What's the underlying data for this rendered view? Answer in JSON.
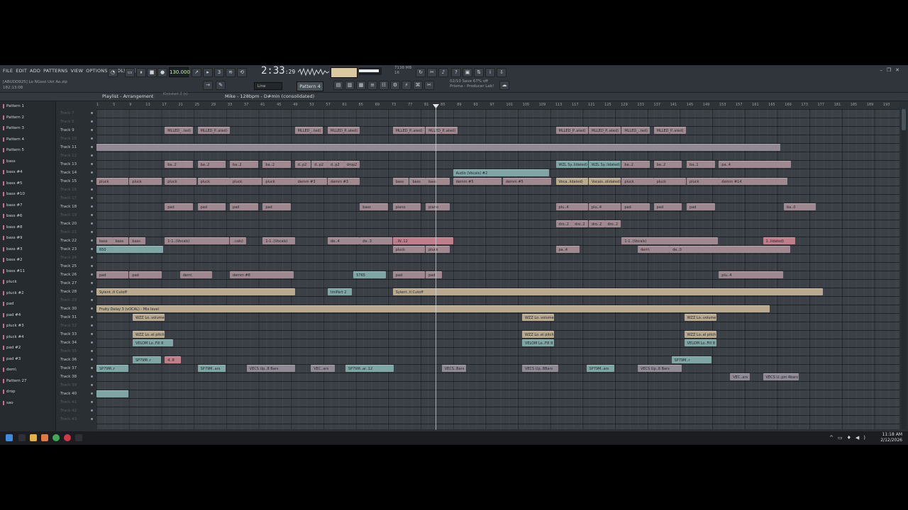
{
  "menu": [
    "FILE",
    "EDIT",
    "ADD",
    "PATTERNS",
    "VIEW",
    "OPTIONS",
    "TOOLS",
    "HELP"
  ],
  "project": {
    "file": "[ABUDD925] Lo NGooi Uot Ao.zip",
    "position": "182:13:08",
    "track_hint": "Track 26"
  },
  "transport": {
    "tempo": "130.000",
    "time_main": "2:33",
    "time_sub": ":29",
    "cpu": "7138 MB",
    "cpu2": "16"
  },
  "toolbar": {
    "snap": "Line",
    "pattern": "Pattern 4"
  },
  "news": {
    "line1": "02/10 Save 67% off",
    "line2": "Prisma - Producer Lab!"
  },
  "playlist": {
    "title": "Playlist - Arrangement",
    "sub": "Kickstart 2 (s)",
    "arrangement": "Mike - 128bpm - D#min (consolidated)"
  },
  "ruler": [
    "1",
    "5",
    "9",
    "13",
    "17",
    "21",
    "25",
    "29",
    "33",
    "37",
    "41",
    "45",
    "49",
    "53",
    "57",
    "61",
    "65",
    "69",
    "73",
    "77",
    "81",
    "85",
    "89",
    "93",
    "97",
    "101",
    "105",
    "109",
    "113",
    "117",
    "121",
    "125",
    "129",
    "133",
    "137",
    "141",
    "145",
    "149",
    "153",
    "157",
    "161",
    "165",
    "169",
    "173",
    "177",
    "181",
    "185",
    "189",
    "193"
  ],
  "picker": [
    "Pattern 1",
    "Pattern 2",
    "Pattern 3",
    "Pattern 4",
    "Pattern 5",
    "bass",
    "bass #4",
    "bass #5",
    "bass #10",
    "bass #7",
    "bass #6",
    "bass #8",
    "bass #9",
    "bass #3",
    "bass #2",
    "bass #11",
    "pluck",
    "pluck #2",
    "pad",
    "pad #4",
    "pluck #3",
    "pluck #4",
    "pad #2",
    "pad #3",
    "dem\\",
    "Pattern 27",
    "drop",
    "sao"
  ],
  "tracks": [
    {
      "name": "Track 7",
      "dim": true
    },
    {
      "name": "Track 8",
      "dim": true
    },
    {
      "name": "Track 9"
    },
    {
      "name": "Track 10",
      "dim": true
    },
    {
      "name": "Track 11"
    },
    {
      "name": "Track 12",
      "dim": true
    },
    {
      "name": "Track 13"
    },
    {
      "name": "Track 14"
    },
    {
      "name": "Track 15"
    },
    {
      "name": "Track 16",
      "dim": true
    },
    {
      "name": "Track 17",
      "dim": true
    },
    {
      "name": "Track 18"
    },
    {
      "name": "Track 19",
      "dim": true
    },
    {
      "name": "Track 20"
    },
    {
      "name": "Track 21",
      "dim": true
    },
    {
      "name": "Track 22"
    },
    {
      "name": "Track 23"
    },
    {
      "name": "Track 24",
      "dim": true
    },
    {
      "name": "Track 25"
    },
    {
      "name": "Track 26"
    },
    {
      "name": "Track 27"
    },
    {
      "name": "Track 28"
    },
    {
      "name": "Track 29",
      "dim": true
    },
    {
      "name": "Track 30"
    },
    {
      "name": "Track 31"
    },
    {
      "name": "Track 32",
      "dim": true
    },
    {
      "name": "Track 33"
    },
    {
      "name": "Track 34"
    },
    {
      "name": "Track 35",
      "dim": true
    },
    {
      "name": "Track 36"
    },
    {
      "name": "Track 37"
    },
    {
      "name": "Track 38"
    },
    {
      "name": "Track 39",
      "dim": true
    },
    {
      "name": "Track 40"
    },
    {
      "name": "Track 41",
      "dim": true
    },
    {
      "name": "Track 42",
      "dim": true
    },
    {
      "name": "Track 43",
      "dim": true
    }
  ],
  "clips": [
    {
      "row": 2,
      "label": "MLLED_..ted)",
      "color": "a",
      "start": 0.085,
      "len": 0.035
    },
    {
      "row": 2,
      "label": "MLLED_P..ated)",
      "color": "a",
      "start": 0.126,
      "len": 0.04
    },
    {
      "row": 2,
      "label": "MLLED_..ted)",
      "color": "a",
      "start": 0.247,
      "len": 0.035
    },
    {
      "row": 2,
      "label": "MLLED_P..ated)",
      "color": "a",
      "start": 0.288,
      "len": 0.04
    },
    {
      "row": 2,
      "label": "MLLED_P..ated)",
      "color": "a",
      "start": 0.369,
      "len": 0.04
    },
    {
      "row": 2,
      "label": "MLLED_P..ated)",
      "color": "a",
      "start": 0.41,
      "len": 0.04
    },
    {
      "row": 2,
      "label": "MLLED_P..ated)",
      "color": "a",
      "start": 0.572,
      "len": 0.04
    },
    {
      "row": 2,
      "label": "MLLED_P..ated)",
      "color": "a",
      "start": 0.613,
      "len": 0.04
    },
    {
      "row": 2,
      "label": "MLLED_..ted)",
      "color": "a",
      "start": 0.654,
      "len": 0.035
    },
    {
      "row": 2,
      "label": "MLLED_P..ated)",
      "color": "a",
      "start": 0.694,
      "len": 0.04
    },
    {
      "row": 4,
      "label": "",
      "color": "b",
      "start": 0.0,
      "len": 0.852
    },
    {
      "row": 6,
      "label": "ba..2",
      "color": "a",
      "start": 0.085,
      "len": 0.035
    },
    {
      "row": 6,
      "label": "ba..2",
      "color": "a",
      "start": 0.126,
      "len": 0.035
    },
    {
      "row": 6,
      "label": "ba..2",
      "color": "a",
      "start": 0.166,
      "len": 0.035
    },
    {
      "row": 6,
      "label": "ba..2",
      "color": "a",
      "start": 0.207,
      "len": 0.035
    },
    {
      "row": 6,
      "label": "d..p2",
      "color": "a",
      "start": 0.247,
      "len": 0.02
    },
    {
      "row": 6,
      "label": "d..p2",
      "color": "a",
      "start": 0.268,
      "len": 0.02
    },
    {
      "row": 6,
      "label": "d..p2",
      "color": "a",
      "start": 0.288,
      "len": 0.02
    },
    {
      "row": 6,
      "label": "drop2",
      "color": "a",
      "start": 0.308,
      "len": 0.02
    },
    {
      "row": 6,
      "label": "WZL Sy..lidated)",
      "color": "c",
      "start": 0.572,
      "len": 0.04
    },
    {
      "row": 6,
      "label": "WZL Sy..lidated)",
      "color": "c",
      "start": 0.613,
      "len": 0.04
    },
    {
      "row": 6,
      "label": "ba..2",
      "color": "a",
      "start": 0.654,
      "len": 0.035
    },
    {
      "row": 6,
      "label": "ba..2",
      "color": "a",
      "start": 0.694,
      "len": 0.035
    },
    {
      "row": 6,
      "label": "ba..1",
      "color": "a",
      "start": 0.735,
      "len": 0.035
    },
    {
      "row": 6,
      "label": "pa..4",
      "color": "a",
      "start": 0.775,
      "len": 0.09
    },
    {
      "row": 7,
      "label": "Audio (Vocals) #2",
      "color": "c",
      "start": 0.444,
      "len": 0.12
    },
    {
      "row": 8,
      "label": "pluck",
      "color": "a",
      "start": 0.0,
      "len": 0.04
    },
    {
      "row": 8,
      "label": "pluck",
      "color": "a",
      "start": 0.041,
      "len": 0.04
    },
    {
      "row": 8,
      "label": "pluck",
      "color": "a",
      "start": 0.085,
      "len": 0.04
    },
    {
      "row": 8,
      "label": "pluck",
      "color": "a",
      "start": 0.126,
      "len": 0.04
    },
    {
      "row": 8,
      "label": "pluck",
      "color": "a",
      "start": 0.166,
      "len": 0.04
    },
    {
      "row": 8,
      "label": "pluck",
      "color": "a",
      "start": 0.207,
      "len": 0.04
    },
    {
      "row": 8,
      "label": "demm #3",
      "color": "a",
      "start": 0.247,
      "len": 0.04
    },
    {
      "row": 8,
      "label": "demm #3",
      "color": "a",
      "start": 0.288,
      "len": 0.04
    },
    {
      "row": 8,
      "label": "bass",
      "color": "a",
      "start": 0.369,
      "len": 0.02
    },
    {
      "row": 8,
      "label": "bass",
      "color": "a",
      "start": 0.39,
      "len": 0.02
    },
    {
      "row": 8,
      "label": "bass",
      "color": "a",
      "start": 0.41,
      "len": 0.03
    },
    {
      "row": 8,
      "label": "demm #5",
      "color": "a",
      "start": 0.444,
      "len": 0.06
    },
    {
      "row": 8,
      "label": "demm #5",
      "color": "a",
      "start": 0.506,
      "len": 0.06
    },
    {
      "row": 8,
      "label": "Voca..lidated)",
      "color": "d",
      "start": 0.572,
      "len": 0.04
    },
    {
      "row": 8,
      "label": "Vocals..olidated)",
      "color": "d",
      "start": 0.613,
      "len": 0.04
    },
    {
      "row": 8,
      "label": "pluck",
      "color": "a",
      "start": 0.654,
      "len": 0.04
    },
    {
      "row": 8,
      "label": "pluck",
      "color": "a",
      "start": 0.694,
      "len": 0.04
    },
    {
      "row": 8,
      "label": "pluck",
      "color": "a",
      "start": 0.735,
      "len": 0.04
    },
    {
      "row": 8,
      "label": "demm #14",
      "color": "a",
      "start": 0.775,
      "len": 0.085
    },
    {
      "row": 11,
      "label": "pad",
      "color": "a",
      "start": 0.085,
      "len": 0.035
    },
    {
      "row": 11,
      "label": "pad",
      "color": "a",
      "start": 0.126,
      "len": 0.035
    },
    {
      "row": 11,
      "label": "pad",
      "color": "a",
      "start": 0.166,
      "len": 0.035
    },
    {
      "row": 11,
      "label": "pad",
      "color": "a",
      "start": 0.207,
      "len": 0.035
    },
    {
      "row": 11,
      "label": "bass",
      "color": "a",
      "start": 0.328,
      "len": 0.035
    },
    {
      "row": 11,
      "label": "piano",
      "color": "a",
      "start": 0.369,
      "len": 0.035
    },
    {
      "row": 11,
      "label": "piano",
      "color": "a",
      "start": 0.41,
      "len": 0.03
    },
    {
      "row": 11,
      "label": "plu..4",
      "color": "a",
      "start": 0.572,
      "len": 0.04
    },
    {
      "row": 11,
      "label": "plu..4",
      "color": "a",
      "start": 0.613,
      "len": 0.04
    },
    {
      "row": 11,
      "label": "pad",
      "color": "a",
      "start": 0.654,
      "len": 0.035
    },
    {
      "row": 11,
      "label": "pad",
      "color": "a",
      "start": 0.694,
      "len": 0.035
    },
    {
      "row": 11,
      "label": "pad",
      "color": "a",
      "start": 0.735,
      "len": 0.035
    },
    {
      "row": 11,
      "label": "ba..0",
      "color": "a",
      "start": 0.856,
      "len": 0.04
    },
    {
      "row": 13,
      "label": "dro..2",
      "color": "a",
      "start": 0.572,
      "len": 0.02
    },
    {
      "row": 13,
      "label": "dro..2",
      "color": "a",
      "start": 0.592,
      "len": 0.02
    },
    {
      "row": 13,
      "label": "dro..2",
      "color": "a",
      "start": 0.613,
      "len": 0.02
    },
    {
      "row": 13,
      "label": "dro..2",
      "color": "a",
      "start": 0.633,
      "len": 0.02
    },
    {
      "row": 15,
      "label": "bass",
      "color": "a",
      "start": 0.0,
      "len": 0.02
    },
    {
      "row": 15,
      "label": "bass",
      "color": "a",
      "start": 0.02,
      "len": 0.02
    },
    {
      "row": 15,
      "label": "bass",
      "color": "a",
      "start": 0.041,
      "len": 0.02
    },
    {
      "row": 15,
      "label": "1-1..(Vocals)",
      "color": "a",
      "start": 0.085,
      "len": 0.08
    },
    {
      "row": 15,
      "label": "..cals)",
      "color": "a",
      "start": 0.166,
      "len": 0.02
    },
    {
      "row": 15,
      "label": "1-1..(Vocals)",
      "color": "a",
      "start": 0.207,
      "len": 0.04
    },
    {
      "row": 15,
      "label": "de..4",
      "color": "a",
      "start": 0.288,
      "len": 0.04
    },
    {
      "row": 15,
      "label": "de..3",
      "color": "a",
      "start": 0.328,
      "len": 0.04
    },
    {
      "row": 15,
      "label": "..W..12",
      "color": "e",
      "start": 0.369,
      "len": 0.075
    },
    {
      "row": 15,
      "label": "1-1..(Vocals)",
      "color": "a",
      "start": 0.654,
      "len": 0.12
    },
    {
      "row": 15,
      "label": "1..lidated)",
      "color": "e",
      "start": 0.83,
      "len": 0.04
    },
    {
      "row": 16,
      "label": "650",
      "color": "c",
      "start": 0.0,
      "len": 0.083
    },
    {
      "row": 16,
      "label": "pluck",
      "color": "a",
      "start": 0.369,
      "len": 0.04
    },
    {
      "row": 16,
      "label": "pluck",
      "color": "a",
      "start": 0.41,
      "len": 0.03
    },
    {
      "row": 16,
      "label": "pa..4",
      "color": "a",
      "start": 0.572,
      "len": 0.03
    },
    {
      "row": 16,
      "label": "dem\\",
      "color": "a",
      "start": 0.674,
      "len": 0.04
    },
    {
      "row": 16,
      "label": "de..0",
      "color": "a",
      "start": 0.714,
      "len": 0.15
    },
    {
      "row": 19,
      "label": "pad",
      "color": "a",
      "start": 0.0,
      "len": 0.04
    },
    {
      "row": 19,
      "label": "pad",
      "color": "a",
      "start": 0.041,
      "len": 0.04
    },
    {
      "row": 19,
      "label": "dem\\",
      "color": "a",
      "start": 0.104,
      "len": 0.04
    },
    {
      "row": 19,
      "label": "demm #8",
      "color": "a",
      "start": 0.166,
      "len": 0.08
    },
    {
      "row": 19,
      "label": "5765",
      "color": "c",
      "start": 0.32,
      "len": 0.04
    },
    {
      "row": 19,
      "label": "pad",
      "color": "a",
      "start": 0.369,
      "len": 0.04
    },
    {
      "row": 19,
      "label": "pad",
      "color": "a",
      "start": 0.41,
      "len": 0.02
    },
    {
      "row": 19,
      "label": "plu..4",
      "color": "a",
      "start": 0.775,
      "len": 0.08
    },
    {
      "row": 21,
      "label": "Sylent..tl Cutoff",
      "color": "d",
      "start": 0.0,
      "len": 0.247
    },
    {
      "row": 21,
      "label": "Sylent..tl Cutoff",
      "color": "d",
      "start": 0.369,
      "len": 0.536
    },
    {
      "row": 21,
      "label": "ImiPart 2",
      "color": "c",
      "start": 0.288,
      "len": 0.03
    },
    {
      "row": 23,
      "label": "Fruity Delay 3 (vOCAL) - Mix level",
      "color": "d",
      "start": 0.0,
      "len": 0.838
    },
    {
      "row": 24,
      "label": "WZZ Lo..volume",
      "color": "d",
      "start": 0.045,
      "len": 0.04
    },
    {
      "row": 24,
      "label": "WZZ Lo..volume",
      "color": "d",
      "start": 0.53,
      "len": 0.04
    },
    {
      "row": 24,
      "label": "WZZ Lo..volume",
      "color": "d",
      "start": 0.732,
      "len": 0.04
    },
    {
      "row": 26,
      "label": "WZZ Lo..el pitch",
      "color": "d",
      "start": 0.045,
      "len": 0.04
    },
    {
      "row": 26,
      "label": "WZZ Lo..el pitch",
      "color": "d",
      "start": 0.53,
      "len": 0.04
    },
    {
      "row": 26,
      "label": "WZZ Lo..el pitch",
      "color": "d",
      "start": 0.732,
      "len": 0.04
    },
    {
      "row": 27,
      "label": "VELOM Lo..Fill 8",
      "color": "c",
      "start": 0.045,
      "len": 0.05
    },
    {
      "row": 27,
      "label": "VELOM Lo..Fill 8",
      "color": "c",
      "start": 0.53,
      "len": 0.04
    },
    {
      "row": 27,
      "label": "VELOM Lo..Fill 8",
      "color": "c",
      "start": 0.732,
      "len": 0.04
    },
    {
      "row": 29,
      "label": "SP79M..r",
      "color": "c",
      "start": 0.045,
      "len": 0.035
    },
    {
      "row": 29,
      "label": "4..8",
      "color": "e",
      "start": 0.085,
      "len": 0.02
    },
    {
      "row": 29,
      "label": "SP79M..r",
      "color": "c",
      "start": 0.716,
      "len": 0.05
    },
    {
      "row": 30,
      "label": "SP79M..r",
      "color": "c",
      "start": 0.0,
      "len": 0.04
    },
    {
      "row": 30,
      "label": "SP79M..ars",
      "color": "c",
      "start": 0.126,
      "len": 0.035
    },
    {
      "row": 30,
      "label": "VECS Up..8 Bars",
      "color": "b",
      "start": 0.187,
      "len": 0.06
    },
    {
      "row": 30,
      "label": "VEC..ars",
      "color": "b",
      "start": 0.267,
      "len": 0.03
    },
    {
      "row": 30,
      "label": "SP79M..ar..12",
      "color": "c",
      "start": 0.31,
      "len": 0.06
    },
    {
      "row": 30,
      "label": "VECS..Bars",
      "color": "b",
      "start": 0.43,
      "len": 0.03
    },
    {
      "row": 30,
      "label": "VECS Up..8Bars",
      "color": "b",
      "start": 0.53,
      "len": 0.045
    },
    {
      "row": 30,
      "label": "SP79M..ars",
      "color": "c",
      "start": 0.61,
      "len": 0.035
    },
    {
      "row": 30,
      "label": "VECS Up..8 Bars",
      "color": "b",
      "start": 0.674,
      "len": 0.055
    },
    {
      "row": 31,
      "label": "VEC..ars",
      "color": "b",
      "start": 0.789,
      "len": 0.025
    },
    {
      "row": 31,
      "label": "VECS U..pm 4bars",
      "color": "b",
      "start": 0.83,
      "len": 0.045
    },
    {
      "row": 33,
      "label": "",
      "color": "c",
      "start": 0.0,
      "len": 0.04
    }
  ],
  "taskbar": {
    "time": "11:18 AM",
    "date": "2/12/2026"
  }
}
